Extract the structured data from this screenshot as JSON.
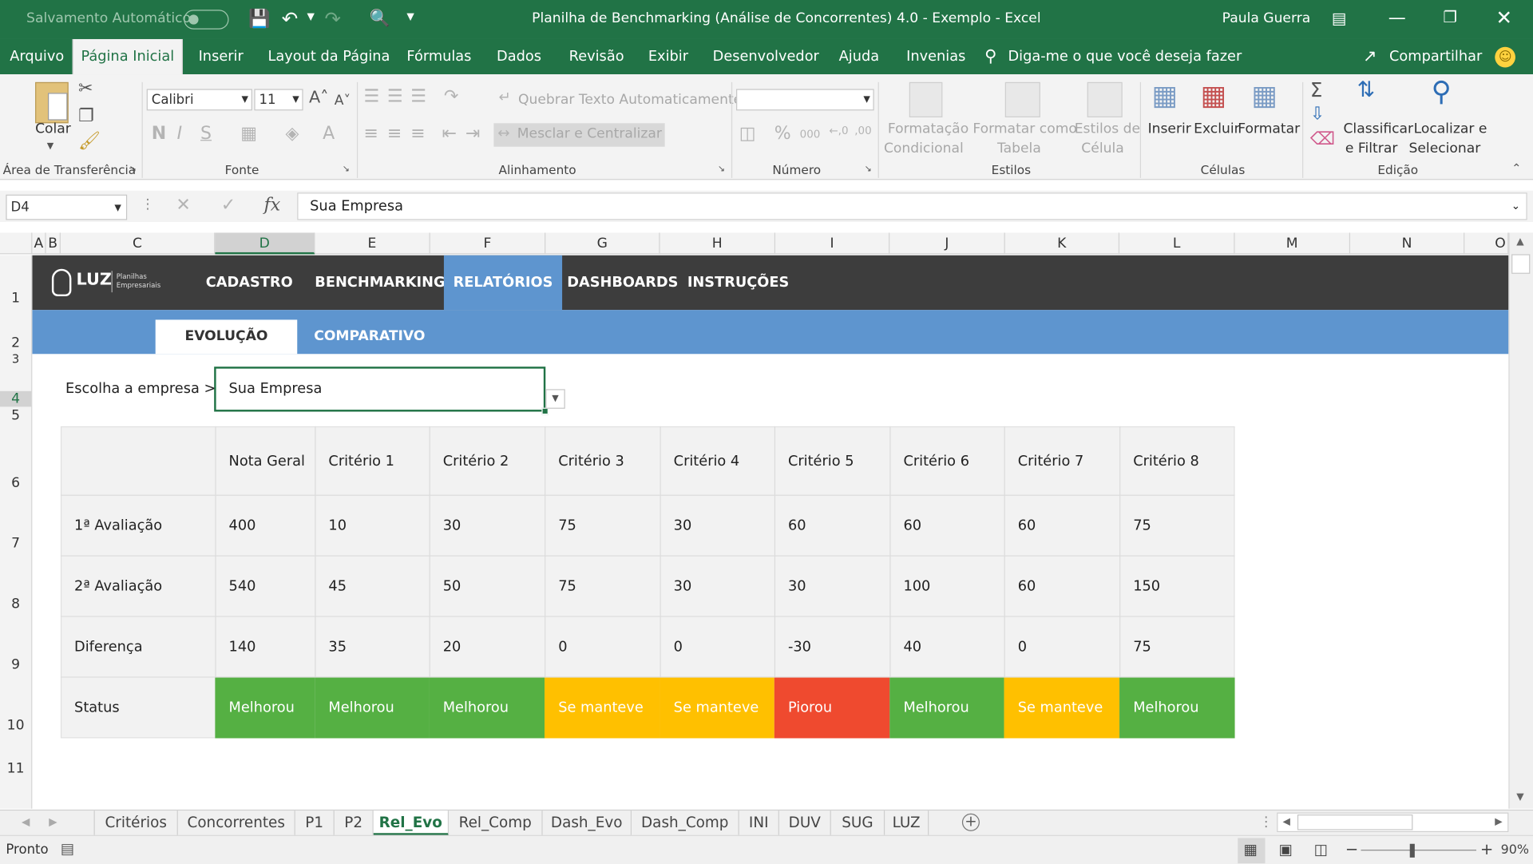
{
  "titlebar": {
    "autosave_label": "Salvamento Automático",
    "title": "Planilha de Benchmarking (Análise de Concorrentes) 4.0 - Exemplo  -  Excel",
    "user": "Paula Guerra"
  },
  "menu": {
    "items": [
      "Arquivo",
      "Página Inicial",
      "Inserir",
      "Layout da Página",
      "Fórmulas",
      "Dados",
      "Revisão",
      "Exibir",
      "Desenvolvedor",
      "Ajuda",
      "Invenias"
    ],
    "tell_me": "Diga-me o que você deseja fazer",
    "share": "Compartilhar"
  },
  "ribbon": {
    "clipboard": {
      "paste": "Colar",
      "label": "Área de Transferência"
    },
    "font": {
      "name": "Calibri",
      "size": "11",
      "label": "Fonte"
    },
    "alignment": {
      "wrap": "Quebrar Texto Automaticamente",
      "merge": "Mesclar e Centralizar",
      "label": "Alinhamento"
    },
    "number": {
      "label": "Número",
      "percent": "%",
      "thousands": "000"
    },
    "styles": {
      "conditional_1": "Formatação",
      "conditional_2": "Condicional",
      "table_1": "Formatar como",
      "table_2": "Tabela",
      "cell_1": "Estilos de",
      "cell_2": "Célula",
      "label": "Estilos"
    },
    "cells": {
      "insert": "Inserir",
      "delete": "Excluir",
      "format": "Formatar",
      "label": "Células"
    },
    "editing": {
      "sort_1": "Classificar",
      "sort_2": "e Filtrar",
      "find_1": "Localizar e",
      "find_2": "Selecionar",
      "label": "Edição"
    }
  },
  "formula_bar": {
    "name_box": "D4",
    "value": "Sua Empresa"
  },
  "columns": [
    "A",
    "B",
    "C",
    "D",
    "E",
    "F",
    "G",
    "H",
    "I",
    "J",
    "K",
    "L",
    "M",
    "N",
    "O"
  ],
  "rows": [
    "1",
    "2",
    "3",
    "4",
    "5",
    "6",
    "7",
    "8",
    "9",
    "10",
    "11"
  ],
  "sheet": {
    "logo_text": "LUZ",
    "logo_sub_1": "Planilhas",
    "logo_sub_2": "Empresariais",
    "nav": [
      "CADASTRO",
      "BENCHMARKING",
      "RELATÓRIOS",
      "DASHBOARDS",
      "INSTRUÇÕES"
    ],
    "nav_active": "RELATÓRIOS",
    "subnav": [
      "EVOLUÇÃO",
      "COMPARATIVO"
    ],
    "subnav_active": "EVOLUÇÃO",
    "select_label": "Escolha a empresa >",
    "select_value": "Sua Empresa",
    "table": {
      "headers": [
        "Nota Geral",
        "Critério 1",
        "Critério 2",
        "Critério 3",
        "Critério 4",
        "Critério 5",
        "Critério 6",
        "Critério 7",
        "Critério 8"
      ],
      "rows": [
        {
          "label": "1ª Avaliação",
          "values": [
            "400",
            "10",
            "30",
            "75",
            "30",
            "60",
            "60",
            "60",
            "75"
          ]
        },
        {
          "label": "2ª Avaliação",
          "values": [
            "540",
            "45",
            "50",
            "75",
            "30",
            "30",
            "100",
            "60",
            "150"
          ]
        },
        {
          "label": "Diferença",
          "values": [
            "140",
            "35",
            "20",
            "0",
            "0",
            "-30",
            "40",
            "0",
            "75"
          ]
        }
      ],
      "status_label": "Status",
      "status": [
        "Melhorou",
        "Melhorou",
        "Melhorou",
        "Se manteve",
        "Se manteve",
        "Piorou",
        "Melhorou",
        "Se manteve",
        "Melhorou"
      ]
    },
    "status_colors": {
      "Melhorou": "#55b043",
      "Se manteve": "#ffc000",
      "Piorou": "#ef4a2f"
    }
  },
  "tabs": [
    "Critérios",
    "Concorrentes",
    "P1",
    "P2",
    "Rel_Evo",
    "Rel_Comp",
    "Dash_Evo",
    "Dash_Comp",
    "INI",
    "DUV",
    "SUG",
    "LUZ"
  ],
  "active_tab": "Rel_Evo",
  "statusbar": {
    "ready": "Pronto",
    "zoom": "90%"
  },
  "colors": {
    "excel_green": "#217346",
    "nav_dark": "#3d3d3d",
    "nav_blue": "#5e95cf"
  }
}
